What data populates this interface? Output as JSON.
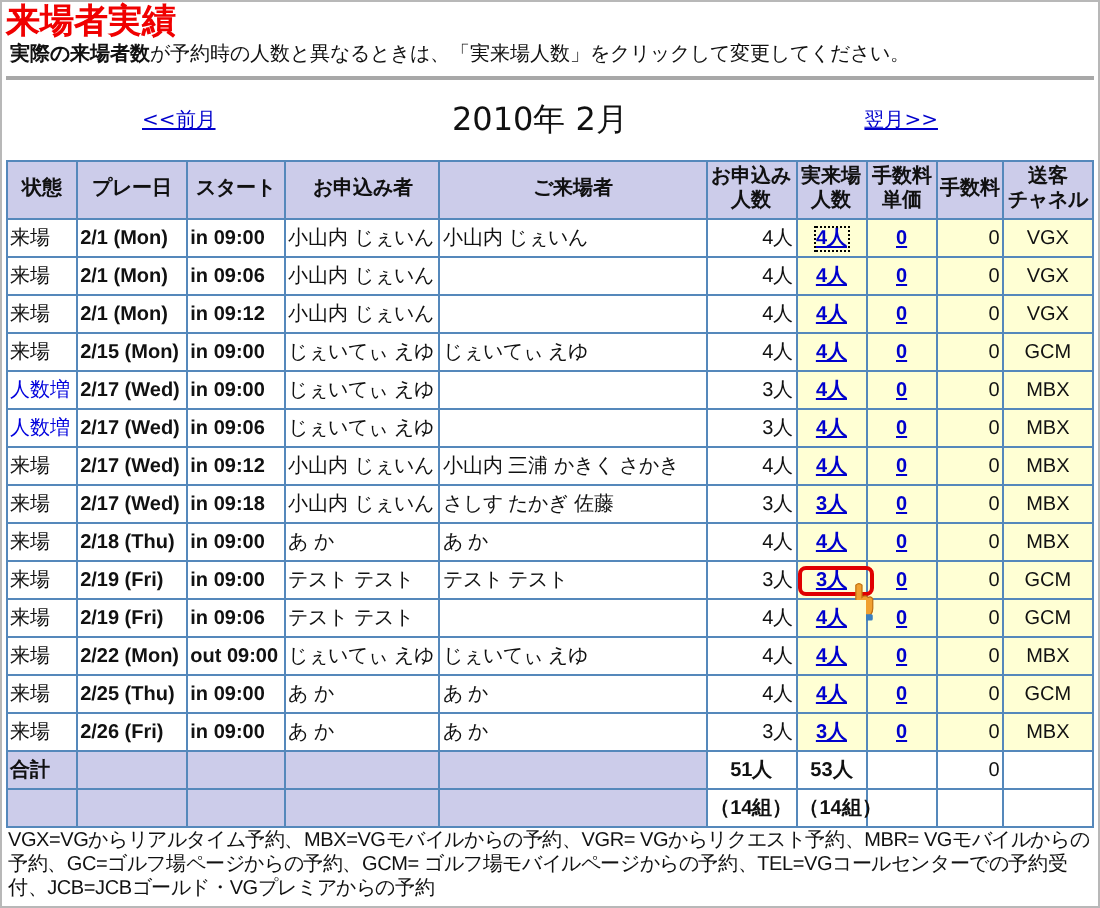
{
  "title": "来場者実績",
  "notice": "**実際の来場者数**が予約時の人数と異なるときは、「実来場人数」をクリックして変更してください。",
  "nav": {
    "prev": "<<前月",
    "month": "2010年 2月",
    "next": "翌月>>"
  },
  "table": {
    "columns": [
      {
        "lines": [
          "状態"
        ]
      },
      {
        "lines": [
          "プレー日"
        ]
      },
      {
        "lines": [
          "スタート"
        ]
      },
      {
        "lines": [
          "お申込み者"
        ]
      },
      {
        "lines": [
          "ご来場者"
        ]
      },
      {
        "lines": [
          "お申込み",
          "人数"
        ]
      },
      {
        "lines": [
          "実来場",
          "人数"
        ]
      },
      {
        "lines": [
          "手数料",
          "単価"
        ]
      },
      {
        "lines": [
          "手数料"
        ]
      },
      {
        "lines": [
          "送客",
          "チャネル"
        ]
      }
    ],
    "rows": [
      {
        "status": "来場",
        "increased": false,
        "date": "2/1 (Mon)",
        "start": "in 09:00",
        "applicant": "小山内 じぇいん",
        "visitor": "小山内 じぇいん",
        "booked": "4人",
        "actual": "4人",
        "focused": true,
        "highlighted": false,
        "fee_unit": "0",
        "fee": "0",
        "channel": "VGX"
      },
      {
        "status": "来場",
        "increased": false,
        "date": "2/1 (Mon)",
        "start": "in 09:06",
        "applicant": "小山内 じぇいん",
        "booked": "4人",
        "actual": "4人",
        "focused": false,
        "highlighted": false,
        "fee_unit": "0",
        "fee": "0",
        "channel": "VGX"
      },
      {
        "status": "来場",
        "increased": false,
        "date": "2/1 (Mon)",
        "start": "in 09:12",
        "applicant": "小山内 じぇいん",
        "booked": "4人",
        "actual": "4人",
        "focused": false,
        "highlighted": false,
        "fee_unit": "0",
        "fee": "0",
        "channel": "VGX"
      },
      {
        "status": "来場",
        "increased": false,
        "date": "2/15 (Mon)",
        "start": "in 09:00",
        "applicant": "じぇいてぃ えゆ",
        "visitor": "じぇいてぃ えゆ",
        "booked": "4人",
        "actual": "4人",
        "focused": false,
        "highlighted": false,
        "fee_unit": "0",
        "fee": "0",
        "channel": "GCM"
      },
      {
        "status": "人数増",
        "increased": true,
        "date": "2/17 (Wed)",
        "start": "in 09:00",
        "applicant": "じぇいてぃ えゆ",
        "booked": "3人",
        "actual": "4人",
        "focused": false,
        "highlighted": false,
        "fee_unit": "0",
        "fee": "0",
        "channel": "MBX"
      },
      {
        "status": "人数増",
        "increased": true,
        "date": "2/17 (Wed)",
        "start": "in 09:06",
        "applicant": "じぇいてぃ えゆ",
        "booked": "3人",
        "actual": "4人",
        "focused": false,
        "highlighted": false,
        "fee_unit": "0",
        "fee": "0",
        "channel": "MBX"
      },
      {
        "status": "来場",
        "increased": false,
        "date": "2/17 (Wed)",
        "start": "in 09:12",
        "applicant": "小山内 じぇいん",
        "visitor": "小山内 三浦 かきく さかき",
        "booked": "4人",
        "actual": "4人",
        "focused": false,
        "highlighted": false,
        "fee_unit": "0",
        "fee": "0",
        "channel": "MBX"
      },
      {
        "status": "来場",
        "increased": false,
        "date": "2/17 (Wed)",
        "start": "in 09:18",
        "applicant": "小山内 じぇいん",
        "visitor": "さしす たかぎ 佐藤",
        "booked": "3人",
        "actual": "3人",
        "focused": false,
        "highlighted": false,
        "fee_unit": "0",
        "fee": "0",
        "channel": "MBX"
      },
      {
        "status": "来場",
        "increased": false,
        "date": "2/18 (Thu)",
        "start": "in 09:00",
        "applicant": "あ か",
        "visitor": "あ か",
        "booked": "4人",
        "actual": "4人",
        "focused": false,
        "highlighted": false,
        "fee_unit": "0",
        "fee": "0",
        "channel": "MBX"
      },
      {
        "status": "来場",
        "increased": false,
        "date": "2/19 (Fri)",
        "start": "in 09:00",
        "applicant": "テスト テスト",
        "visitor": "テスト テスト",
        "booked": "3人",
        "actual": "3人",
        "focused": false,
        "highlighted": true,
        "fee_unit": "0",
        "fee": "0",
        "channel": "GCM"
      },
      {
        "status": "来場",
        "increased": false,
        "date": "2/19 (Fri)",
        "start": "in 09:06",
        "applicant": "テスト テスト",
        "booked": "4人",
        "actual": "4人",
        "focused": false,
        "highlighted": false,
        "fee_unit": "0",
        "fee": "0",
        "channel": "GCM"
      },
      {
        "status": "来場",
        "increased": false,
        "date": "2/22 (Mon)",
        "start": "out 09:00",
        "applicant": "じぇいてぃ えゆ",
        "visitor": "じぇいてぃ えゆ",
        "booked": "4人",
        "actual": "4人",
        "focused": false,
        "highlighted": false,
        "fee_unit": "0",
        "fee": "0",
        "channel": "MBX"
      },
      {
        "status": "来場",
        "increased": false,
        "date": "2/25 (Thu)",
        "start": "in 09:00",
        "applicant": "あ か",
        "visitor": "あ か",
        "booked": "4人",
        "actual": "4人",
        "focused": false,
        "highlighted": false,
        "fee_unit": "0",
        "fee": "0",
        "channel": "GCM"
      },
      {
        "status": "来場",
        "increased": false,
        "date": "2/26 (Fri)",
        "start": "in 09:00",
        "applicant": "あ か",
        "visitor": "あ か",
        "booked": "3人",
        "actual": "3人",
        "focused": false,
        "highlighted": false,
        "fee_unit": "0",
        "fee": "0",
        "channel": "MBX"
      }
    ],
    "totals": {
      "label": "合計",
      "booked": "51人",
      "actual": "53人",
      "fee": "0",
      "booked_groups": "（14組）",
      "actual_groups": "（14組）"
    }
  },
  "footnote": "VGX=VGからリアルタイム予約、MBX=VGモバイルからの予約、VGR= VGからリクエスト予約、MBR= VGモバイルからの予約、GC=ゴルフ場ページからの予約、GCM= ゴルフ場モバイルページからの予約、TEL=VGコールセンターでの予約受付、JCB=JCBゴールド・VGプレミアからの予約"
}
